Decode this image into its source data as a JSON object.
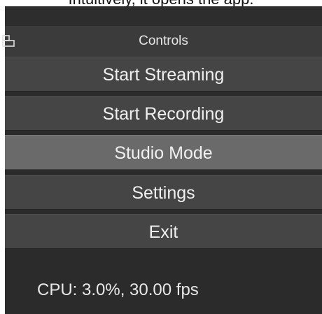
{
  "top_partial_text": "Intuitively, it opens the app.",
  "controls": {
    "title": "Controls",
    "float_icon": "undock-icon",
    "buttons": [
      {
        "label": "Start Streaming",
        "active": false
      },
      {
        "label": "Start Recording",
        "active": false
      },
      {
        "label": "Studio Mode",
        "active": true
      },
      {
        "label": "Settings",
        "active": false
      },
      {
        "label": "Exit",
        "active": false
      }
    ]
  },
  "status": {
    "cpu_text": "CPU: 3.0%, 30.00 fps"
  },
  "colors": {
    "panel_bg": "#2b2b2b",
    "header_bg": "#3b3b3b",
    "button_bg": "#454545",
    "button_active_bg": "#6a6a6a",
    "text": "#f0f0f0"
  }
}
